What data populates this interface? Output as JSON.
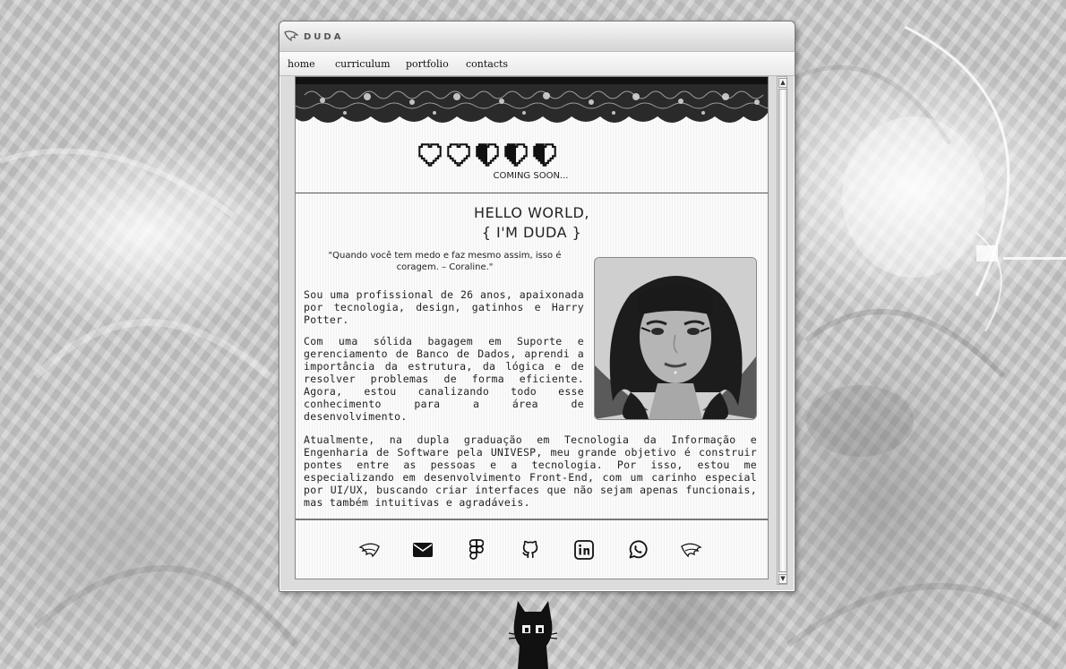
{
  "window": {
    "title": "DUDA"
  },
  "menu": {
    "items": [
      {
        "label": "home"
      },
      {
        "label": "curriculum"
      },
      {
        "label": "portfolio"
      },
      {
        "label": "contacts"
      }
    ]
  },
  "status": {
    "coming_soon": "COMING SOON..."
  },
  "intro": {
    "hello": "HELLO WORLD,",
    "name": "{ I'M DUDA }",
    "quote": "\"Quando você tem medo e faz mesmo assim, isso é coragem. – Coraline.\"",
    "paragraph_1": "Sou uma profissional de 26 anos, apaixonada por tecnologia, design, gatinhos e Harry Potter.",
    "paragraph_2": "Com uma sólida bagagem em Suporte e gerenciamento de Banco de Dados, aprendi a importância da estrutura, da lógica e de resolver problemas de forma eficiente. Agora, estou canalizando todo esse conhecimento para a área de desenvolvimento.",
    "paragraph_3": "Atualmente, na dupla graduação em Tecnologia da Informação e Engenharia de Software pela UNIVESP, meu grande objetivo é construir pontes entre as pessoas e a tecnologia. Por isso, estou me especializando em desenvolvimento Front-End, com um carinho especial por UI/UX, buscando criar interfaces que não sejam apenas funcionais, mas também intuitivas e agradáveis."
  },
  "hearts": {
    "count": 5,
    "states": [
      "empty",
      "empty",
      "half",
      "half",
      "half"
    ]
  },
  "socials": [
    {
      "icon": "wing-left-icon"
    },
    {
      "icon": "mail-icon"
    },
    {
      "icon": "figma-icon"
    },
    {
      "icon": "github-icon"
    },
    {
      "icon": "linkedin-icon"
    },
    {
      "icon": "whatsapp-icon"
    },
    {
      "icon": "wing-right-icon"
    }
  ]
}
